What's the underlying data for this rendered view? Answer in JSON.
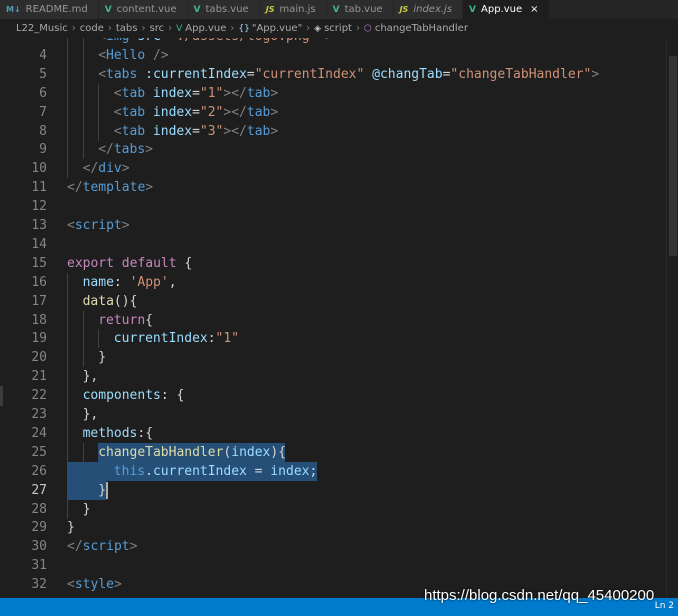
{
  "tabs": [
    {
      "icon": "M↓",
      "icon_kind": "md",
      "label": "README.md",
      "active": false,
      "italic": false
    },
    {
      "icon": "V",
      "icon_kind": "vue",
      "label": "content.vue",
      "active": false,
      "italic": false
    },
    {
      "icon": "V",
      "icon_kind": "vue",
      "label": "tabs.vue",
      "active": false,
      "italic": false
    },
    {
      "icon": "JS",
      "icon_kind": "js",
      "label": "main.js",
      "active": false,
      "italic": false
    },
    {
      "icon": "V",
      "icon_kind": "vue",
      "label": "tab.vue",
      "active": false,
      "italic": false
    },
    {
      "icon": "JS",
      "icon_kind": "js",
      "label": "index.js",
      "active": false,
      "italic": true
    },
    {
      "icon": "V",
      "icon_kind": "vue",
      "label": "App.vue",
      "active": true,
      "italic": false
    }
  ],
  "breadcrumb": {
    "parts": [
      "L22_Music",
      "code",
      "tabs",
      "src",
      "App.vue",
      "\"App.vue\"",
      "script",
      "changeTabHandler"
    ],
    "separator": "›"
  },
  "editor": {
    "current_line": "27",
    "lines": [
      {
        "n": "",
        "indent": 2,
        "tokens": [
          [
            "tk-punct",
            "<"
          ],
          [
            "tk-tag",
            "img"
          ],
          [
            "tk-attr",
            " src"
          ],
          [
            "tk-op",
            "="
          ],
          [
            "tk-str",
            "\"./assets/logo.png\""
          ],
          [
            "tk-punct",
            " >"
          ]
        ],
        "partial": true
      },
      {
        "n": "4",
        "indent": 2,
        "tokens": [
          [
            "tk-punct",
            "<"
          ],
          [
            "tk-tag",
            "Hello"
          ],
          [
            "tk-punct",
            " />"
          ]
        ]
      },
      {
        "n": "5",
        "indent": 2,
        "tokens": [
          [
            "tk-punct",
            "<"
          ],
          [
            "tk-tag",
            "tabs"
          ],
          [
            "tk-attr",
            " :currentIndex"
          ],
          [
            "tk-op",
            "="
          ],
          [
            "tk-str",
            "\"currentIndex\""
          ],
          [
            "tk-attr",
            " @changTab"
          ],
          [
            "tk-op",
            "="
          ],
          [
            "tk-str",
            "\"changeTabHandler\""
          ],
          [
            "tk-punct",
            ">"
          ]
        ]
      },
      {
        "n": "6",
        "indent": 3,
        "tokens": [
          [
            "tk-punct",
            "<"
          ],
          [
            "tk-tag",
            "tab"
          ],
          [
            "tk-attr",
            " index"
          ],
          [
            "tk-op",
            "="
          ],
          [
            "tk-str",
            "\"1\""
          ],
          [
            "tk-punct",
            "></"
          ],
          [
            "tk-tag",
            "tab"
          ],
          [
            "tk-punct",
            ">"
          ]
        ]
      },
      {
        "n": "7",
        "indent": 3,
        "tokens": [
          [
            "tk-punct",
            "<"
          ],
          [
            "tk-tag",
            "tab"
          ],
          [
            "tk-attr",
            " index"
          ],
          [
            "tk-op",
            "="
          ],
          [
            "tk-str",
            "\"2\""
          ],
          [
            "tk-punct",
            "></"
          ],
          [
            "tk-tag",
            "tab"
          ],
          [
            "tk-punct",
            ">"
          ]
        ]
      },
      {
        "n": "8",
        "indent": 3,
        "tokens": [
          [
            "tk-punct",
            "<"
          ],
          [
            "tk-tag",
            "tab"
          ],
          [
            "tk-attr",
            " index"
          ],
          [
            "tk-op",
            "="
          ],
          [
            "tk-str",
            "\"3\""
          ],
          [
            "tk-punct",
            "></"
          ],
          [
            "tk-tag",
            "tab"
          ],
          [
            "tk-punct",
            ">"
          ]
        ]
      },
      {
        "n": "9",
        "indent": 2,
        "tokens": [
          [
            "tk-punct",
            "</"
          ],
          [
            "tk-tag",
            "tabs"
          ],
          [
            "tk-punct",
            ">"
          ]
        ]
      },
      {
        "n": "10",
        "indent": 1,
        "tokens": [
          [
            "tk-punct",
            "</"
          ],
          [
            "tk-tag",
            "div"
          ],
          [
            "tk-punct",
            ">"
          ]
        ]
      },
      {
        "n": "11",
        "indent": 0,
        "tokens": [
          [
            "tk-punct",
            "</"
          ],
          [
            "tk-tag",
            "template"
          ],
          [
            "tk-punct",
            ">"
          ]
        ]
      },
      {
        "n": "12",
        "indent": 0,
        "tokens": []
      },
      {
        "n": "13",
        "indent": 0,
        "tokens": [
          [
            "tk-punct",
            "<"
          ],
          [
            "tk-tag",
            "script"
          ],
          [
            "tk-punct",
            ">"
          ]
        ]
      },
      {
        "n": "14",
        "indent": 0,
        "tokens": []
      },
      {
        "n": "15",
        "indent": 0,
        "tokens": [
          [
            "tk-kw",
            "export"
          ],
          [
            "tk-txt",
            " "
          ],
          [
            "tk-kw",
            "default"
          ],
          [
            "tk-txt",
            " {"
          ]
        ]
      },
      {
        "n": "16",
        "indent": 1,
        "tokens": [
          [
            "tk-prop",
            "name"
          ],
          [
            "tk-txt",
            ": "
          ],
          [
            "tk-str",
            "'App'"
          ],
          [
            "tk-txt",
            ","
          ]
        ]
      },
      {
        "n": "17",
        "indent": 1,
        "tokens": [
          [
            "tk-fn",
            "data"
          ],
          [
            "tk-txt",
            "(){"
          ]
        ]
      },
      {
        "n": "18",
        "indent": 2,
        "tokens": [
          [
            "tk-kw",
            "return"
          ],
          [
            "tk-txt",
            "{"
          ]
        ]
      },
      {
        "n": "19",
        "indent": 3,
        "tokens": [
          [
            "tk-prop",
            "currentIndex"
          ],
          [
            "tk-txt",
            ":"
          ],
          [
            "tk-str",
            "\"1\""
          ]
        ]
      },
      {
        "n": "20",
        "indent": 2,
        "tokens": [
          [
            "tk-txt",
            "}"
          ]
        ]
      },
      {
        "n": "21",
        "indent": 1,
        "tokens": [
          [
            "tk-txt",
            "},"
          ]
        ]
      },
      {
        "n": "22",
        "indent": 1,
        "tokens": [
          [
            "tk-prop",
            "components"
          ],
          [
            "tk-txt",
            ": {"
          ]
        ]
      },
      {
        "n": "23",
        "indent": 1,
        "tokens": [
          [
            "tk-txt",
            "},"
          ]
        ]
      },
      {
        "n": "24",
        "indent": 1,
        "tokens": [
          [
            "tk-prop",
            "methods"
          ],
          [
            "tk-txt",
            ":{"
          ]
        ]
      },
      {
        "n": "25",
        "indent": 2,
        "tokens": [
          [
            "tk-fn",
            "changeTabHandler"
          ],
          [
            "tk-txt",
            "("
          ],
          [
            "tk-prop",
            "index"
          ],
          [
            "tk-txt",
            "){"
          ]
        ],
        "sel": "text"
      },
      {
        "n": "26",
        "indent": 3,
        "tokens": [
          [
            "tk-this",
            "this"
          ],
          [
            "tk-txt",
            "."
          ],
          [
            "tk-prop",
            "currentIndex"
          ],
          [
            "tk-txt",
            " = "
          ],
          [
            "tk-prop",
            "index"
          ],
          [
            "tk-txt",
            ";"
          ]
        ],
        "sel": "full"
      },
      {
        "n": "27",
        "indent": 2,
        "tokens": [
          [
            "tk-txt",
            "}"
          ]
        ],
        "sel": "upto"
      },
      {
        "n": "28",
        "indent": 1,
        "tokens": [
          [
            "tk-txt",
            "}"
          ]
        ]
      },
      {
        "n": "29",
        "indent": 0,
        "tokens": [
          [
            "tk-txt",
            "}"
          ]
        ]
      },
      {
        "n": "30",
        "indent": 0,
        "tokens": [
          [
            "tk-punct",
            "</"
          ],
          [
            "tk-tag",
            "script"
          ],
          [
            "tk-punct",
            ">"
          ]
        ]
      },
      {
        "n": "31",
        "indent": 0,
        "tokens": []
      },
      {
        "n": "32",
        "indent": 0,
        "tokens": [
          [
            "tk-punct",
            "<"
          ],
          [
            "tk-tag",
            "style"
          ],
          [
            "tk-punct",
            ">"
          ]
        ]
      }
    ]
  },
  "status": {
    "position": "Ln 2"
  },
  "watermark": "https://blog.csdn.net/qq_45400200",
  "colors": {
    "accent": "#007acc",
    "selection": "#264f78",
    "background": "#1e1e1e"
  }
}
